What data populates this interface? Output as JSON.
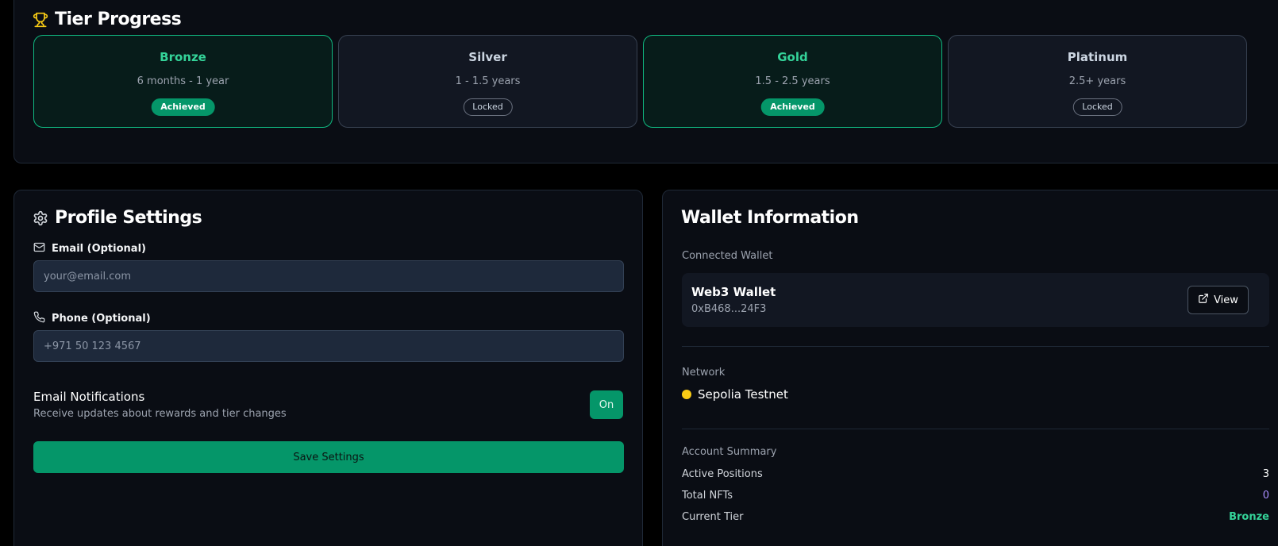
{
  "tier_progress": {
    "title": "Tier Progress",
    "tiers": [
      {
        "name": "Bronze",
        "range": "6 months - 1 year",
        "status": "Achieved"
      },
      {
        "name": "Silver",
        "range": "1 - 1.5 years",
        "status": "Locked"
      },
      {
        "name": "Gold",
        "range": "1.5 - 2.5 years",
        "status": "Achieved"
      },
      {
        "name": "Platinum",
        "range": "2.5+ years",
        "status": "Locked"
      }
    ]
  },
  "profile": {
    "title": "Profile Settings",
    "email_label": "Email (Optional)",
    "email_placeholder": "your@email.com",
    "email_value": "",
    "phone_label": "Phone (Optional)",
    "phone_placeholder": "+971 50 123 4567",
    "phone_value": "",
    "notifications_title": "Email Notifications",
    "notifications_desc": "Receive updates about rewards and tier changes",
    "notifications_toggle": "On",
    "save_label": "Save Settings"
  },
  "wallet": {
    "title": "Wallet Information",
    "connected_label": "Connected Wallet",
    "wallet_name": "Web3 Wallet",
    "wallet_address": "0xB468...24F3",
    "view_label": "View",
    "network_label": "Network",
    "network_name": "Sepolia Testnet",
    "summary_label": "Account Summary",
    "summary": [
      {
        "label": "Active Positions",
        "value": "3",
        "color": "#ffffff"
      },
      {
        "label": "Total NFTs",
        "value": "0",
        "color": "#a78bfa"
      },
      {
        "label": "Current Tier",
        "value": "Bronze",
        "color": "#34d399"
      }
    ]
  },
  "colors": {
    "accent": "#059669",
    "achieved_text": "#34d399",
    "network_dot": "#facc15",
    "icon_trophy": "#facc15"
  },
  "icons": [
    "trophy-icon",
    "gear-icon",
    "mail-icon",
    "phone-icon",
    "external-link-icon"
  ]
}
